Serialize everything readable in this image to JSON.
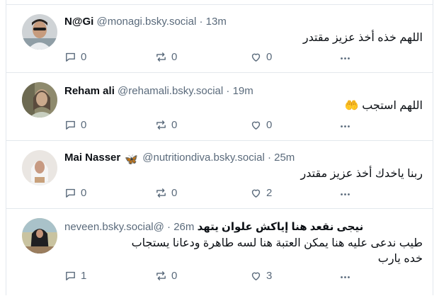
{
  "colors": {
    "border": "#e3e8ed",
    "muted": "#5a6a7b",
    "text": "#0b0f14"
  },
  "posts": [
    {
      "name": "N@Gi",
      "handle": "@monagi.bsky.social",
      "time": "13m",
      "text": "اللهم خذه أخذ عزيز مقتدر",
      "replies": "0",
      "reposts": "0",
      "likes": "0"
    },
    {
      "name": "Reham ali",
      "handle": "@rehamali.bsky.social",
      "time": "19m",
      "text": "اللهم استجب",
      "text_emoji": "🤲",
      "replies": "0",
      "reposts": "0",
      "likes": "0"
    },
    {
      "name": "Mai Nasser",
      "name_emoji": "🦋",
      "handle": "@nutritiondiva.bsky.social",
      "time": "25m",
      "text": "ربنا ياخدك أخذ عزيز مقتدر",
      "replies": "0",
      "reposts": "0",
      "likes": "2"
    },
    {
      "name": "نيجى نقعد هنا إياكش علوان يتهد",
      "handle": "neveen.bsky.social@",
      "time": "26m",
      "text": "طيب ندعى عليه هنا يمكن العتبة هنا لسه طاهرة ودعانا يستجاب خده يارب",
      "replies": "1",
      "reposts": "0",
      "likes": "3"
    }
  ]
}
